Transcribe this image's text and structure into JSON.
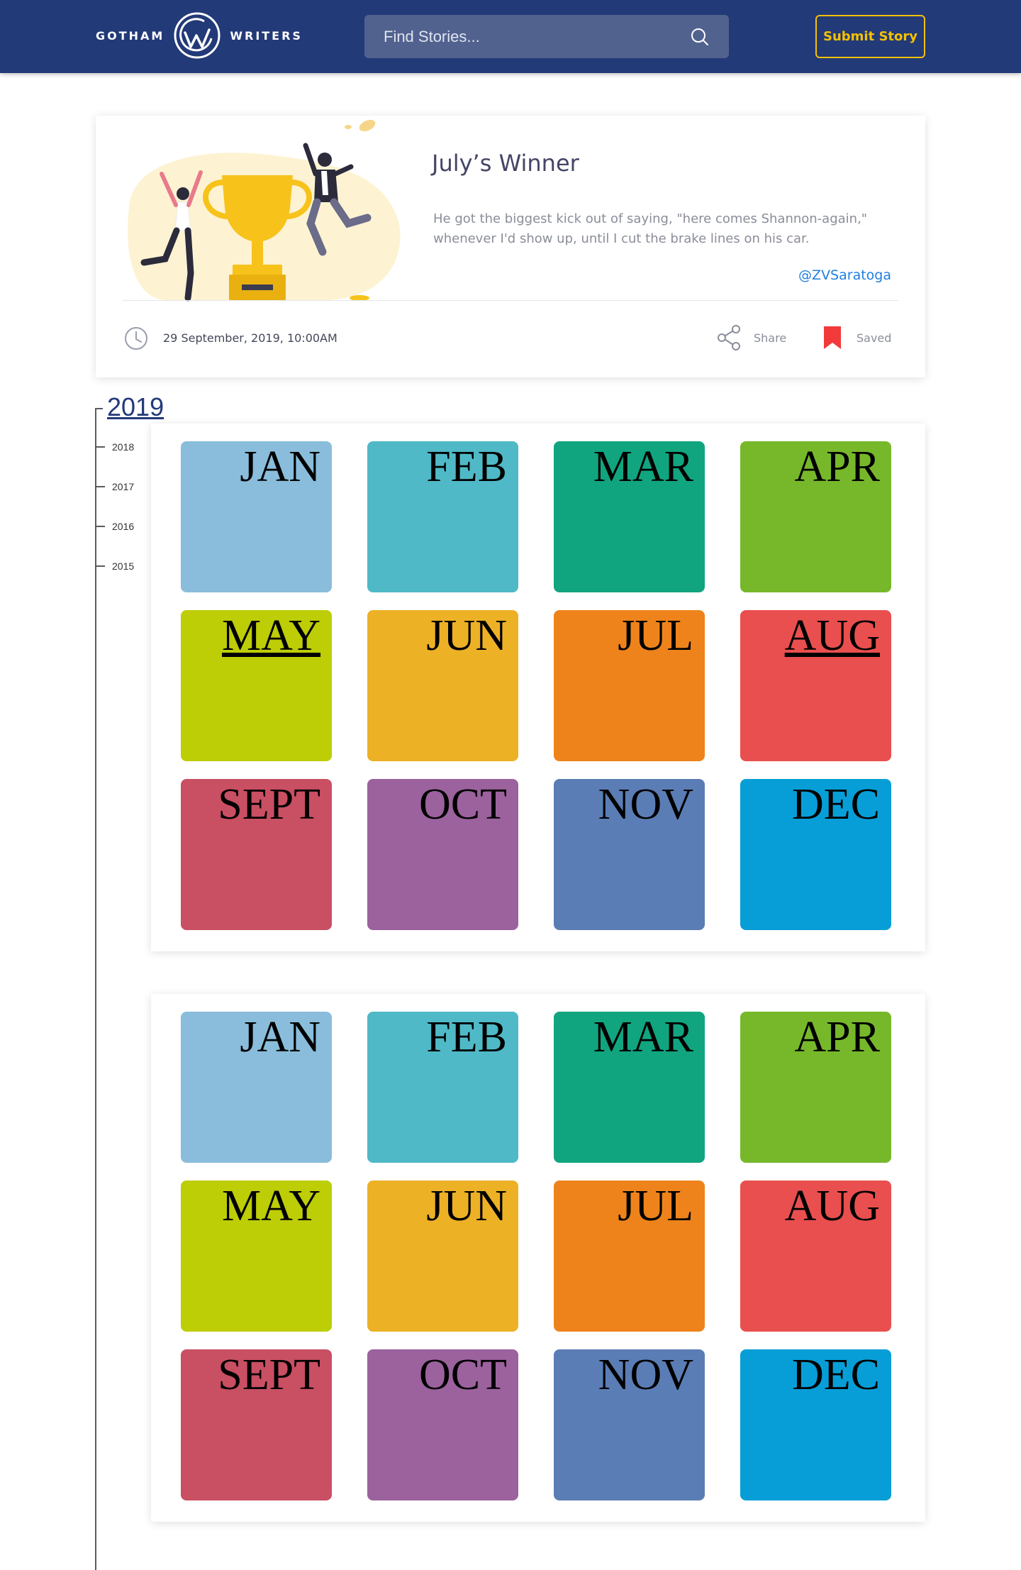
{
  "header": {
    "logo_left": "GOTHAM",
    "logo_right": "WRITERS",
    "search_placeholder": "Find Stories...",
    "submit_label": "Submit Story"
  },
  "winner": {
    "title": "July’s Winner",
    "excerpt": "He got the biggest kick out of saying, \"here comes Shannon-again,\" whenever I'd show up, until I cut the brake lines on his car.",
    "author": "@ZVSaratoga",
    "date": "29 September, 2019, 10:00AM",
    "share_label": "Share",
    "saved_label": "Saved"
  },
  "timeline": {
    "current_year": "2019",
    "years": [
      "2018",
      "2017",
      "2016",
      "2015"
    ]
  },
  "panels": [
    {
      "months": [
        {
          "label": "JAN",
          "color": "#89bddb",
          "underlined": false
        },
        {
          "label": "FEB",
          "color": "#4fb9c7",
          "underlined": false
        },
        {
          "label": "MAR",
          "color": "#11a57f",
          "underlined": false
        },
        {
          "label": "APR",
          "color": "#77b82b",
          "underlined": false
        },
        {
          "label": "MAY",
          "color": "#bdcd06",
          "underlined": true
        },
        {
          "label": "JUN",
          "color": "#edb126",
          "underlined": false
        },
        {
          "label": "JUL",
          "color": "#ee831b",
          "underlined": false
        },
        {
          "label": "AUG",
          "color": "#e94f4e",
          "underlined": true
        },
        {
          "label": "SEPT",
          "color": "#c94f63",
          "underlined": false
        },
        {
          "label": "OCT",
          "color": "#9b629d",
          "underlined": false
        },
        {
          "label": "NOV",
          "color": "#5b7db5",
          "underlined": false
        },
        {
          "label": "DEC",
          "color": "#079ed7",
          "underlined": false
        }
      ]
    },
    {
      "months": [
        {
          "label": "JAN",
          "color": "#89bddb",
          "underlined": false
        },
        {
          "label": "FEB",
          "color": "#4fb9c7",
          "underlined": false
        },
        {
          "label": "MAR",
          "color": "#11a57f",
          "underlined": false
        },
        {
          "label": "APR",
          "color": "#77b82b",
          "underlined": false
        },
        {
          "label": "MAY",
          "color": "#bdcd06",
          "underlined": false
        },
        {
          "label": "JUN",
          "color": "#edb126",
          "underlined": false
        },
        {
          "label": "JUL",
          "color": "#ee831b",
          "underlined": false
        },
        {
          "label": "AUG",
          "color": "#e94f4e",
          "underlined": false
        },
        {
          "label": "SEPT",
          "color": "#c94f63",
          "underlined": false
        },
        {
          "label": "OCT",
          "color": "#9b629d",
          "underlined": false
        },
        {
          "label": "NOV",
          "color": "#5b7db5",
          "underlined": false
        },
        {
          "label": "DEC",
          "color": "#079ed7",
          "underlined": false
        }
      ]
    }
  ]
}
